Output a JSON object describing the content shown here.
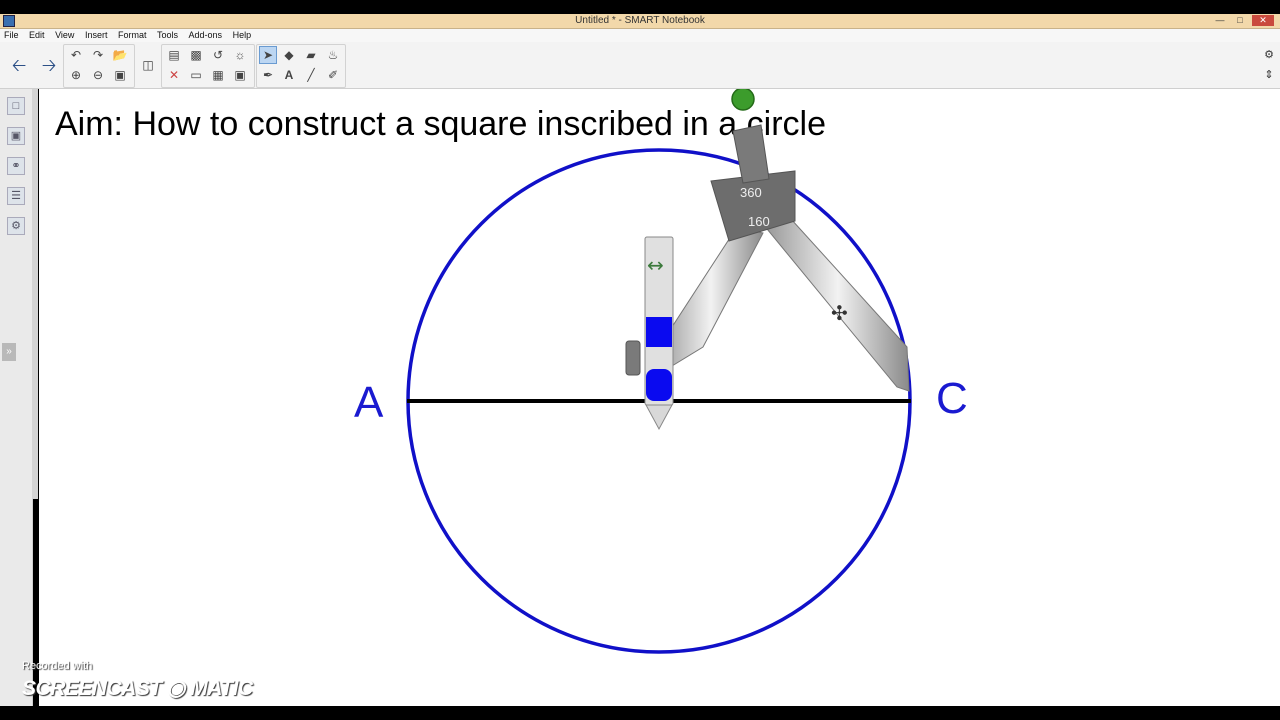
{
  "window": {
    "title": "Untitled * - SMART Notebook",
    "controls": [
      "minimize",
      "maximize",
      "close"
    ]
  },
  "menu": {
    "items": [
      "File",
      "Edit",
      "View",
      "Insert",
      "Format",
      "Tools",
      "Add-ons",
      "Help"
    ]
  },
  "toolbar": {
    "nav": [
      "back-arrow-icon",
      "forward-arrow-icon"
    ],
    "icons_row1": [
      "undo-icon",
      "redo-icon",
      "open-file-icon",
      "paste-icon",
      "screen-capture-icon",
      "page-reset-icon",
      "capture-icon",
      "select-icon",
      "shapes-icon",
      "eraser-icon",
      "fill-icon"
    ],
    "icons_row2": [
      "add-page-icon",
      "delete-page-icon",
      "save-icon",
      "display-icon",
      "delete-icon",
      "screen-shade-icon",
      "table-icon",
      "full-screen-icon",
      "pens-icon",
      "text-icon",
      "line-icon",
      "magic-pen-icon"
    ]
  },
  "sidebar": {
    "tabs": [
      "page-sorter-icon",
      "gallery-icon",
      "attachments-icon",
      "properties-icon",
      "addons-icon"
    ]
  },
  "canvas": {
    "heading": "Aim: How to construct a square inscribed in a circle",
    "label_left": "A",
    "label_right": "C",
    "compass_labels": [
      "360",
      "160"
    ],
    "colors": {
      "circle": "#1010c8",
      "diameter": "#000000",
      "labels": "#1a1ad0",
      "compass_pencil": "#0a0af0"
    }
  },
  "watermark": {
    "line1": "Recorded with",
    "line2": "SCREENCAST",
    "line3": "MATIC"
  }
}
